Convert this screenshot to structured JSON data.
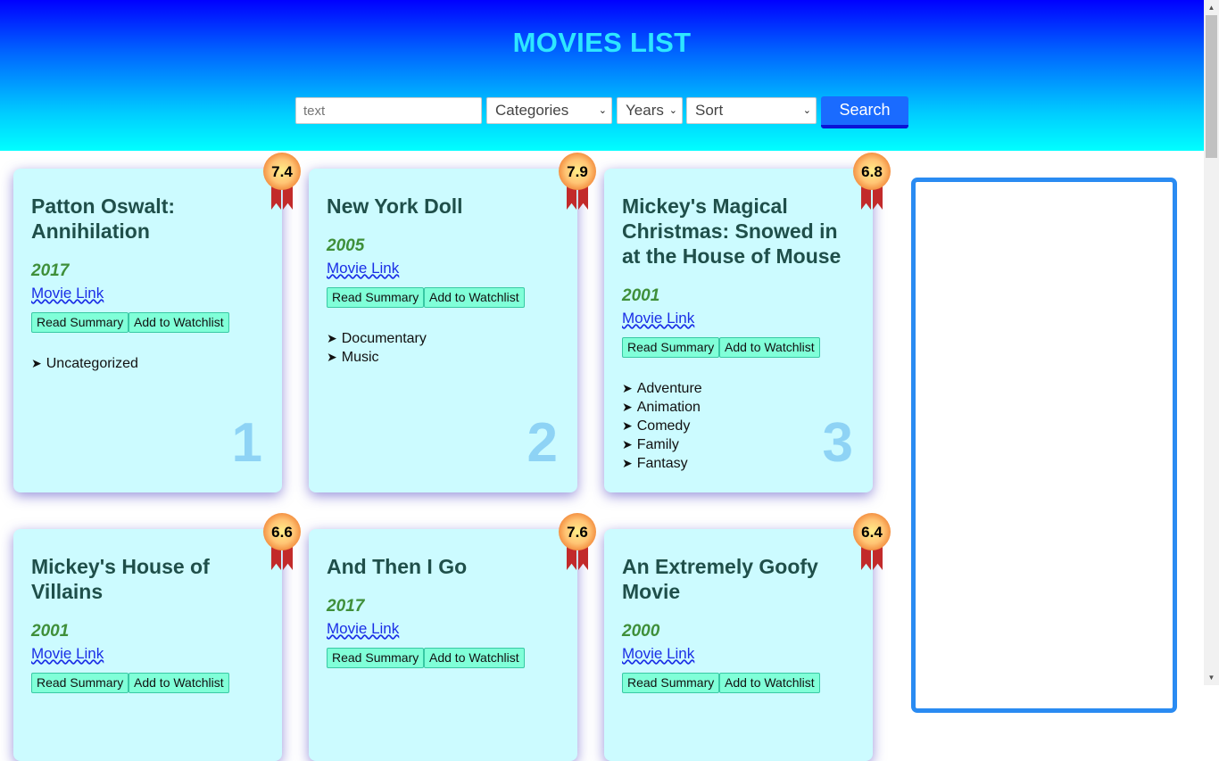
{
  "header": {
    "title": "MOVIES LIST",
    "search_placeholder": "text",
    "categories_label": "Categories",
    "years_label": "Years",
    "sort_label": "Sort",
    "search_button": "Search"
  },
  "cards": [
    {
      "title": "Patton Oswalt: Annihilation",
      "year": "2017",
      "link": "Movie Link",
      "summary_btn": "Read Summary",
      "watch_btn": "Add to Watchlist",
      "rating": "7.4",
      "rank": "1",
      "categories": [
        "Uncategorized"
      ]
    },
    {
      "title": "New York Doll",
      "year": "2005",
      "link": "Movie Link",
      "summary_btn": "Read Summary",
      "watch_btn": "Add to Watchlist",
      "rating": "7.9",
      "rank": "2",
      "categories": [
        "Documentary",
        "Music"
      ]
    },
    {
      "title": "Mickey's Magical Christmas: Snowed in at the House of Mouse",
      "year": "2001",
      "link": "Movie Link",
      "summary_btn": "Read Summary",
      "watch_btn": "Add to Watchlist",
      "rating": "6.8",
      "rank": "3",
      "categories": [
        "Adventure",
        "Animation",
        "Comedy",
        "Family",
        "Fantasy"
      ]
    },
    {
      "title": "Mickey's House of Villains",
      "year": "2001",
      "link": "Movie Link",
      "summary_btn": "Read Summary",
      "watch_btn": "Add to Watchlist",
      "rating": "6.6"
    },
    {
      "title": "And Then I Go",
      "year": "2017",
      "link": "Movie Link",
      "summary_btn": "Read Summary",
      "watch_btn": "Add to Watchlist",
      "rating": "7.6"
    },
    {
      "title": "An Extremely Goofy Movie",
      "year": "2000",
      "link": "Movie Link",
      "summary_btn": "Read Summary",
      "watch_btn": "Add to Watchlist",
      "rating": "6.4"
    }
  ],
  "colors": {
    "header_top": "#0000ff",
    "header_bottom": "#00ffff",
    "title": "#2ee6ff",
    "card_bg": "#ccfbff",
    "button_bg": "#80ffd8",
    "search_button": "#1a6bff",
    "sidebar_border": "#2a8bf2",
    "rank_number": "#8ed3f5"
  },
  "icons": {
    "badge": "ribbon-medal-icon",
    "bullet": "arrow-bullet-icon",
    "dropdown": "chevron-down-icon"
  }
}
